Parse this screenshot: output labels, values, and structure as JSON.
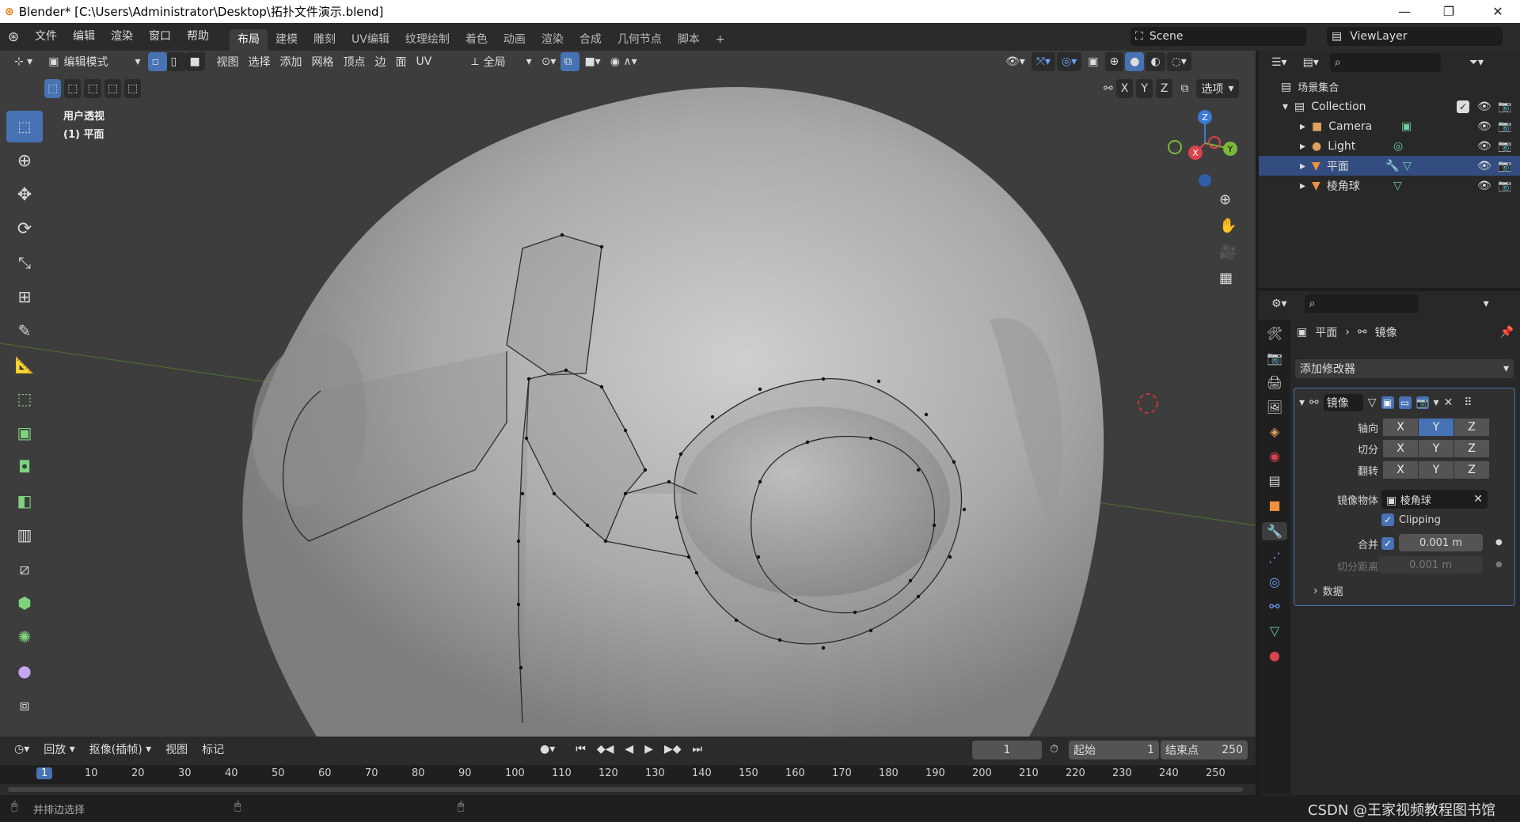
{
  "window": {
    "title": "Blender* [C:\\Users\\Administrator\\Desktop\\拓扑文件演示.blend]"
  },
  "menu": [
    "文件",
    "编辑",
    "渲染",
    "窗口",
    "帮助"
  ],
  "workspaces": [
    {
      "label": "布局",
      "active": true
    },
    {
      "label": "建模"
    },
    {
      "label": "雕刻"
    },
    {
      "label": "UV编辑"
    },
    {
      "label": "纹理绘制"
    },
    {
      "label": "着色"
    },
    {
      "label": "动画"
    },
    {
      "label": "渲染"
    },
    {
      "label": "合成"
    },
    {
      "label": "几何节点"
    },
    {
      "label": "脚本"
    }
  ],
  "scene": {
    "name": "Scene",
    "view_layer": "ViewLayer"
  },
  "viewport": {
    "mode": "编辑模式",
    "menus": [
      "视图",
      "选择",
      "添加",
      "网格",
      "顶点",
      "边",
      "面",
      "UV"
    ],
    "transform_orientation": "全局",
    "axes": [
      "X",
      "Y",
      "Z"
    ],
    "options_label": "选项",
    "overlay_text_1": "用户透视",
    "overlay_text_2": "(1) 平面",
    "gizmo_axes": {
      "x": "X",
      "y": "Y",
      "z": "Z"
    },
    "accent_color": "#4772b3"
  },
  "tools": [
    "select-box",
    "cursor",
    "move",
    "rotate",
    "scale",
    "transform",
    "annotate",
    "measure",
    "add-cube",
    "extrude",
    "inset",
    "bevel",
    "loop-cut",
    "knife",
    "poly-build",
    "spin",
    "smooth",
    "shrink-fatten"
  ],
  "outliner": {
    "root": "场景集合",
    "collection": "Collection",
    "items": [
      {
        "name": "Camera",
        "icon": "camera-icon",
        "color": "#e0a060"
      },
      {
        "name": "Light",
        "icon": "light-icon",
        "color": "#e0a060"
      },
      {
        "name": "平面",
        "icon": "mesh-icon",
        "color": "#f09040"
      },
      {
        "name": "棱角球",
        "icon": "mesh-icon",
        "color": "#f09040"
      }
    ]
  },
  "properties": {
    "breadcrumb_object": "平面",
    "breadcrumb_modifier": "镜像",
    "add_modifier": "添加修改器",
    "modifier_name": "镜像",
    "rows": {
      "axis": "轴向",
      "bisect": "切分",
      "flip": "翻转"
    },
    "axis_letters": [
      "X",
      "Y",
      "Z"
    ],
    "mirror_object_label": "镜像物体",
    "mirror_object_value": "棱角球",
    "clipping_label": "Clipping",
    "merge_label": "合并",
    "merge_value": "0.001 m",
    "bisect_distance_label": "切分距离",
    "bisect_distance_value": "0.001 m",
    "data_label": "数据"
  },
  "timeline": {
    "menus": [
      "回放",
      "抠像(插帧)",
      "视图",
      "标记"
    ],
    "current_frame": "1",
    "start_label": "起始",
    "start_value": "1",
    "end_label": "结束点",
    "end_value": "250",
    "ticks": [
      "1",
      "10",
      "20",
      "30",
      "40",
      "50",
      "60",
      "70",
      "80",
      "90",
      "100",
      "110",
      "120",
      "130",
      "140",
      "150",
      "160",
      "170",
      "180",
      "190",
      "200",
      "210",
      "220",
      "230",
      "240",
      "250"
    ]
  },
  "statusbar": {
    "hint": "并排边选择",
    "watermark": "CSDN @王家视频教程图书馆"
  }
}
